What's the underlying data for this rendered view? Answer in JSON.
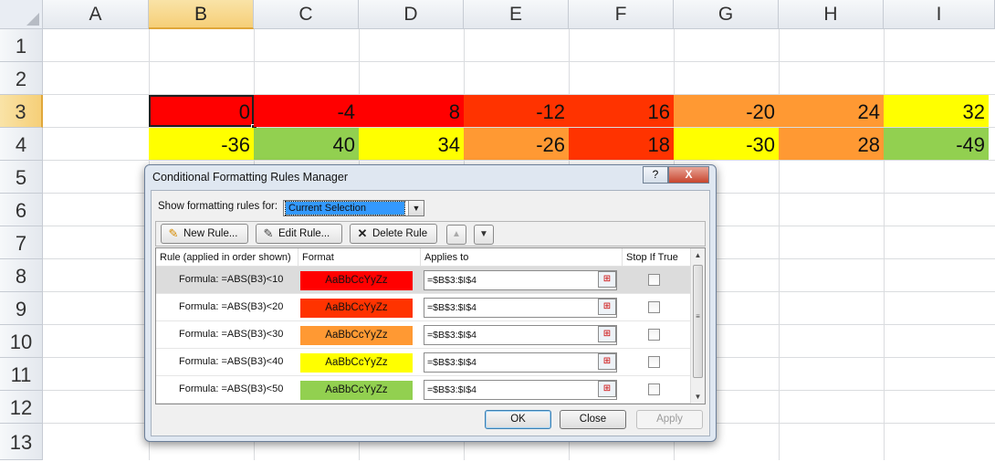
{
  "sheet": {
    "columns": [
      "A",
      "B",
      "C",
      "D",
      "E",
      "F",
      "G",
      "H",
      "I"
    ],
    "selected_column": "B",
    "rows": [
      "1",
      "2",
      "3",
      "4",
      "5",
      "6",
      "7",
      "8",
      "9",
      "10",
      "11",
      "12",
      "13"
    ],
    "selected_row": "3",
    "row3": [
      {
        "col": "B",
        "value": "0",
        "color": "#ff0000"
      },
      {
        "col": "C",
        "value": "-4",
        "color": "#ff0000"
      },
      {
        "col": "D",
        "value": "8",
        "color": "#ff0000"
      },
      {
        "col": "E",
        "value": "-12",
        "color": "#ff3300"
      },
      {
        "col": "F",
        "value": "16",
        "color": "#ff3300"
      },
      {
        "col": "G",
        "value": "-20",
        "color": "#ff9933"
      },
      {
        "col": "H",
        "value": "24",
        "color": "#ff9933"
      },
      {
        "col": "I",
        "value": "32",
        "color": "#ffff00"
      }
    ],
    "row4": [
      {
        "col": "B",
        "value": "-36",
        "color": "#ffff00"
      },
      {
        "col": "C",
        "value": "40",
        "color": "#92d050"
      },
      {
        "col": "D",
        "value": "34",
        "color": "#ffff00"
      },
      {
        "col": "E",
        "value": "-26",
        "color": "#ff9933"
      },
      {
        "col": "F",
        "value": "18",
        "color": "#ff3300"
      },
      {
        "col": "G",
        "value": "-30",
        "color": "#ffff00"
      },
      {
        "col": "H",
        "value": "28",
        "color": "#ff9933"
      },
      {
        "col": "I",
        "value": "-49",
        "color": "#92d050"
      }
    ]
  },
  "dialog": {
    "title": "Conditional Formatting Rules Manager",
    "help_button": "?",
    "close_button": "X",
    "show_label": "Show formatting rules for:",
    "show_value": "Current Selection",
    "toolbar": {
      "new_rule": "New Rule...",
      "edit_rule": "Edit Rule...",
      "delete_rule": "Delete Rule",
      "move_up_icon": "arrow-up-icon",
      "move_down_icon": "arrow-down-icon"
    },
    "headers": {
      "rule": "Rule (applied in order shown)",
      "format": "Format",
      "applies_to": "Applies to",
      "stop_if_true": "Stop If True"
    },
    "rules": [
      {
        "rule": "Formula: =ABS(B3)<10",
        "format_sample": "AaBbCcYyZz",
        "format_color": "#ff0000",
        "applies_to": "=$B$3:$I$4",
        "stop_if_true": false
      },
      {
        "rule": "Formula: =ABS(B3)<20",
        "format_sample": "AaBbCcYyZz",
        "format_color": "#ff3300",
        "applies_to": "=$B$3:$I$4",
        "stop_if_true": false
      },
      {
        "rule": "Formula: =ABS(B3)<30",
        "format_sample": "AaBbCcYyZz",
        "format_color": "#ff9933",
        "applies_to": "=$B$3:$I$4",
        "stop_if_true": false
      },
      {
        "rule": "Formula: =ABS(B3)<40",
        "format_sample": "AaBbCcYyZz",
        "format_color": "#ffff00",
        "applies_to": "=$B$3:$I$4",
        "stop_if_true": false
      },
      {
        "rule": "Formula: =ABS(B3)<50",
        "format_sample": "AaBbCcYyZz",
        "format_color": "#92d050",
        "applies_to": "=$B$3:$I$4",
        "stop_if_true": false
      }
    ],
    "buttons": {
      "ok": "OK",
      "close": "Close",
      "apply": "Apply"
    }
  }
}
